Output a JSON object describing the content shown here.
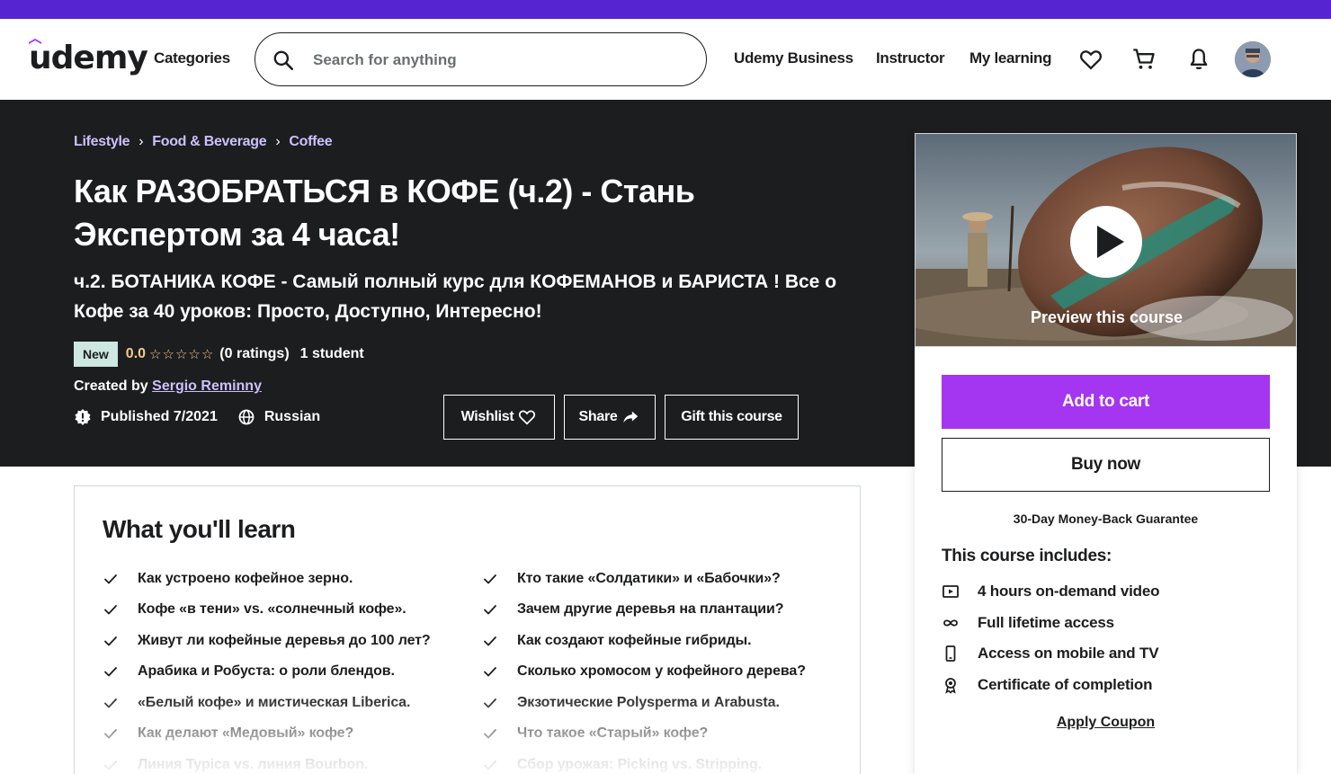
{
  "header": {
    "logo": "udemy",
    "categories": "Categories",
    "search_placeholder": "Search for anything",
    "udemy_business": "Udemy Business",
    "instructor": "Instructor",
    "my_learning": "My learning"
  },
  "colors": {
    "brand": "#5624d0",
    "accent": "#a435f0",
    "dark": "#1c1d1f",
    "link": "#cec0fc",
    "star": "#f3ca8c"
  },
  "course": {
    "breadcrumbs": [
      "Lifestyle",
      "Food & Beverage",
      "Coffee"
    ],
    "title": "Как РАЗОБРАТЬСЯ в КОФЕ (ч.2) - Стань Экспертом за 4 часа!",
    "subtitle": "ч.2. БОТАНИКА КОФЕ - Самый полный курс для КОФЕМАНОВ и БАРИСТА ! Все о Кофе за 40 уроков: Просто, Доступно, Интересно!",
    "badge": "New",
    "rating": "0.0",
    "stars": "☆☆☆☆☆",
    "rating_count": "(0 ratings)",
    "students": "1 student",
    "created_by_label": "Created by",
    "instructor": "Sergio Reminny",
    "published": "Published 7/2021",
    "language": "Russian",
    "wishlist": "Wishlist",
    "share": "Share",
    "gift": "Gift this course"
  },
  "sidebar": {
    "preview_label": "Preview this course",
    "add_to_cart": "Add to cart",
    "buy_now": "Buy now",
    "guarantee": "30-Day Money-Back Guarantee",
    "includes_title": "This course includes:",
    "includes": [
      {
        "icon": "video-icon",
        "text": "4 hours on-demand video"
      },
      {
        "icon": "infinity-icon",
        "text": "Full lifetime access"
      },
      {
        "icon": "mobile-icon",
        "text": "Access on mobile and TV"
      },
      {
        "icon": "certificate-icon",
        "text": "Certificate of completion"
      }
    ],
    "apply_coupon": "Apply Coupon"
  },
  "learn": {
    "title": "What you'll learn",
    "left": [
      "Как устроено кофейное зерно.",
      "Кофе «в тени» vs. «солнечный кофе».",
      "Живут ли кофейные деревья до 100 лет?",
      "Арабика и Робуста: о роли блендов.",
      "«Белый кофе» и мистическая Liberica.",
      "Как делают «Медовый» кофе?",
      "Линия Typica vs. линия Bourbon."
    ],
    "right": [
      "Кто такие «Солдатики» и «Бабочки»?",
      "Зачем другие деревья на плантации?",
      "Как создают кофейные гибриды.",
      "Сколько хромосом у кофейного дерева?",
      "Экзотические Polysperma и Arabusta.",
      "Что такое «Старый» кофе?",
      "Сбор урожая: Picking vs. Stripping."
    ]
  }
}
